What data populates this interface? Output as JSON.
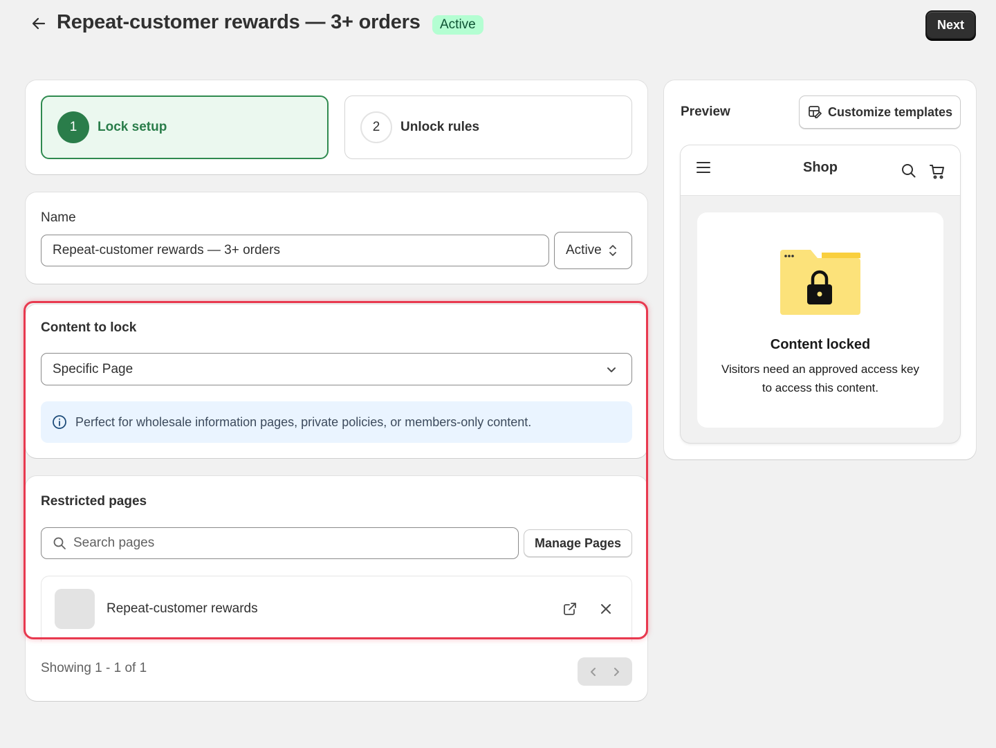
{
  "header": {
    "title": "Repeat-customer rewards — 3+ orders",
    "badge": "Active",
    "next_label": "Next"
  },
  "steps": [
    {
      "number": "1",
      "label": "Lock setup"
    },
    {
      "number": "2",
      "label": "Unlock rules"
    }
  ],
  "name_section": {
    "label": "Name",
    "value": "Repeat-customer rewards — 3+ orders",
    "status": "Active"
  },
  "content_section": {
    "label": "Content to lock",
    "selected": "Specific Page",
    "info": "Perfect for wholesale information pages, private policies, or members-only content."
  },
  "restricted_section": {
    "label": "Restricted pages",
    "search_placeholder": "Search pages",
    "manage_label": "Manage Pages",
    "pages": [
      {
        "title": "Repeat-customer rewards"
      }
    ],
    "showing": "Showing 1 - 1 of 1"
  },
  "preview": {
    "title": "Preview",
    "customize_label": "Customize templates",
    "shop_name": "Shop",
    "locked_title": "Content locked",
    "locked_desc": "Visitors need an approved access key to access this content."
  },
  "colors": {
    "accent": "#2a7d4a",
    "highlight": "#e8394f",
    "info_bg": "#eaf4ff",
    "badge_bg": "#b4fed2"
  }
}
